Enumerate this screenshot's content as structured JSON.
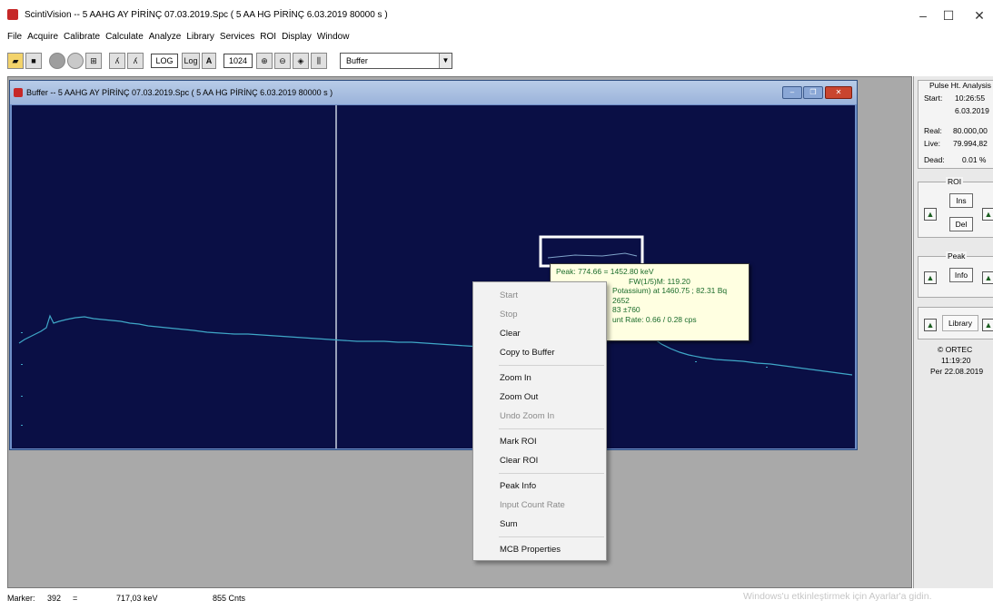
{
  "window": {
    "title": "ScintiVision -- 5 AAHG AY PİRİNÇ 07.03.2019.Spc ( 5 AA HG PİRİNÇ 6.03.2019 80000 s )",
    "minimize": "–",
    "maximize": "☐",
    "close": "✕"
  },
  "menu": [
    "File",
    "Acquire",
    "Calibrate",
    "Calculate",
    "Analyze",
    "Library",
    "Services",
    "ROI",
    "Display",
    "Window"
  ],
  "toolbar": {
    "log_label": "LOG",
    "log_mode": "Log",
    "auto_label": "A",
    "scale_value": "1024",
    "buffer_select": "Buffer"
  },
  "buffer_window": {
    "title": "Buffer -- 5 AAHG AY PİRİNÇ 07.03.2019.Spc ( 5 AA HG PİRİNÇ 6.03.2019 80000 s )"
  },
  "tooltip": {
    "line1": "Peak: 774.66 = 1452.80 keV",
    "line2": "FW(1/5)M: 119.20",
    "line3": "Potassium) at 1460.75 ;  82.31 Bq",
    "line4": "2652",
    "line5": "83 ±760",
    "line6": "unt Rate: 0.66 / 0.28 cps"
  },
  "context_menu": {
    "start": "Start",
    "stop": "Stop",
    "clear": "Clear",
    "copy_to_buffer": "Copy to Buffer",
    "zoom_in": "Zoom In",
    "zoom_out": "Zoom Out",
    "undo_zoom_in": "Undo Zoom In",
    "mark_roi": "Mark ROI",
    "clear_roi": "Clear ROI",
    "peak_info": "Peak Info",
    "input_count_rate": "Input Count Rate",
    "sum": "Sum",
    "mcb_properties": "MCB Properties"
  },
  "right_panel": {
    "pha_title": "Pulse Ht. Analysis",
    "start_label": "Start:",
    "start_time": "10:26:55",
    "start_date": "6.03.2019",
    "real_label": "Real:",
    "real_value": "80.000,00",
    "live_label": "Live:",
    "live_value": "79.994,82",
    "dead_label": "Dead:",
    "dead_value": "0.01  %",
    "roi_title": "ROI",
    "ins_label": "Ins",
    "del_label": "Del",
    "peak_title": "Peak",
    "info_label": "Info",
    "library_label": "Library",
    "ortec": "© ORTEC",
    "clock_time": "11:19:20",
    "clock_date": "Per  22.08.2019"
  },
  "status": {
    "marker_label": "Marker:",
    "marker_channel": "392",
    "equals": "=",
    "energy": "717,03 keV",
    "counts": "855  Cnts"
  },
  "watermark": "Windows'u etkinleştirmek için Ayarlar'a gidin.",
  "colors": {
    "spectrum_bg": "#0a0f45",
    "spectrum_trace": "#3fa7c7",
    "marker_line": "#c8d0e0",
    "tooltip_text": "#1a6b2a"
  }
}
